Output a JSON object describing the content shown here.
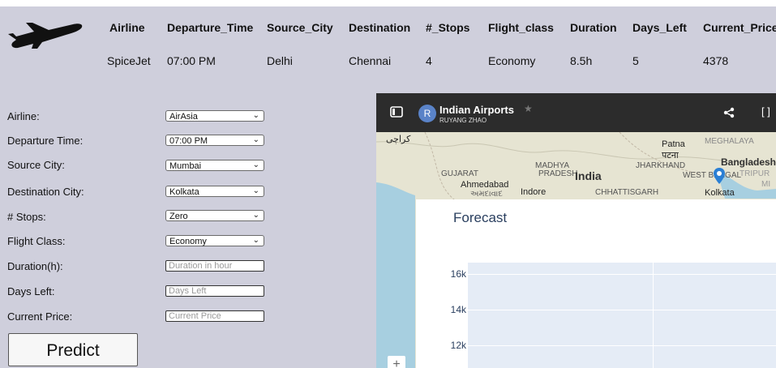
{
  "header": {
    "columns": [
      "Airline",
      "Departure_Time",
      "Source_City",
      "Destination",
      "#_Stops",
      "Flight_class",
      "Duration",
      "Days_Left",
      "Current_Price"
    ],
    "values": [
      "SpiceJet",
      "07:00 PM",
      "Delhi",
      "Chennai",
      "4",
      "Economy",
      "8.5h",
      "5",
      "4378"
    ]
  },
  "form": {
    "airline": {
      "label": "Airline:",
      "value": "AirAsia"
    },
    "departure": {
      "label": "Departure Time:",
      "value": "07:00 PM"
    },
    "source": {
      "label": "Source City:",
      "value": "Mumbai"
    },
    "destination": {
      "label": "Destination City:",
      "value": "Kolkata"
    },
    "stops": {
      "label": "# Stops:",
      "value": "Zero"
    },
    "flight_class": {
      "label": "Flight Class:",
      "value": "Economy"
    },
    "duration": {
      "label": "Duration(h):",
      "placeholder": "Duration in hour"
    },
    "days_left": {
      "label": "Days Left:",
      "placeholder": "Days Left"
    },
    "current_price": {
      "label": "Current Price:",
      "placeholder": "Current Price"
    },
    "predict_label": "Predict"
  },
  "map": {
    "title": "Indian Airports",
    "owner": "RUYANG ZHAO",
    "avatar_letter": "R",
    "labels": {
      "karachi": "کراچی",
      "patna": "Patna",
      "patna_hi": "पटना",
      "bangladesh": "Bangladesh",
      "gujarat": "GUJARAT",
      "madhya": "MADHYA",
      "pradesh": "PRADESH",
      "india": "India",
      "jharkhand": "JHARKHAND",
      "westbengal": "WEST BENGAL",
      "ahmedabad": "Ahmedabad",
      "ahmedabad_gu": "અમદાવાદ",
      "indore": "Indore",
      "chhattisgarh": "CHHATTISGARH",
      "kolkata": "Kolkata",
      "meghalaya": "MEGHALAYA",
      "tripura": "TRIPUR",
      "mi": "MI"
    },
    "icons": [
      "sidebar-toggle-icon",
      "star-icon",
      "share-icon",
      "fullscreen-icon",
      "map-pin-icon",
      "zoom-in-icon"
    ]
  },
  "forecast": {
    "title": "Forecast",
    "y_ticks": [
      "16k",
      "14k",
      "12k"
    ]
  }
}
